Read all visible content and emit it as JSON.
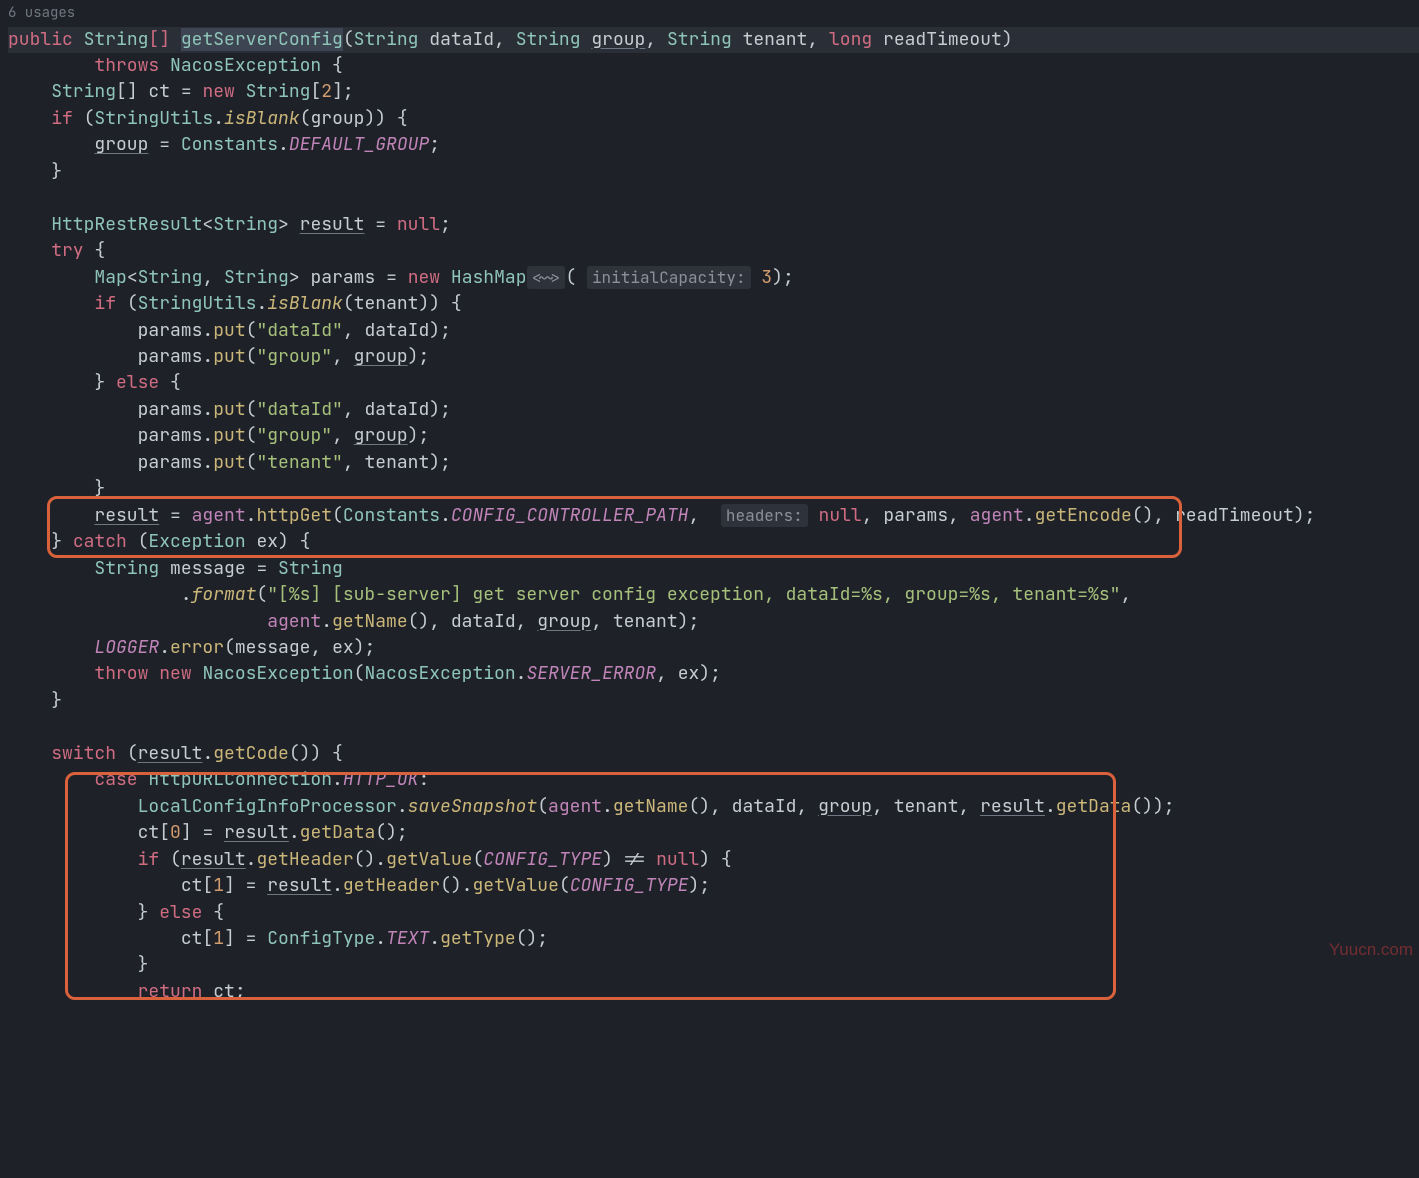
{
  "usages_label": "6 usages",
  "watermark": "Yuucn.com",
  "sig": {
    "public": "public",
    "string": "String",
    "brackets": "[]",
    "method": "getServerConfig",
    "p1t": "String",
    "p1n": "dataId",
    "p2t": "String",
    "p2n": "group",
    "p3t": "String",
    "p3n": "tenant",
    "p4t": "long",
    "p4n": "readTimeout",
    "throws": "throws",
    "exc": "NacosException"
  },
  "l": {
    "String": "String",
    "ct": "ct",
    "new": "new",
    "two": "2",
    "if": "if",
    "StringUtils": "StringUtils",
    "isBlank": "isBlank",
    "group": "group",
    "Constants": "Constants",
    "DEFAULT_GROUP": "DEFAULT_GROUP",
    "HttpRestResult": "HttpRestResult",
    "result": "result",
    "null": "null",
    "try": "try",
    "Map": "Map",
    "params": "params",
    "HashMap": "HashMap",
    "diamond": "<~>",
    "initialCapacity": "initialCapacity:",
    "three": "3",
    "tenant": "tenant",
    "put": "put",
    "dataIdStr": "\"dataId\"",
    "groupStr": "\"group\"",
    "tenantStr": "\"tenant\"",
    "dataId": "dataId",
    "else": "else",
    "agent": "agent",
    "httpGet": "httpGet",
    "CONFIG_CONTROLLER_PATH": "CONFIG_CONTROLLER_PATH",
    "headers": "headers:",
    "getEncode": "getEncode",
    "readTimeout": "readTimeout",
    "catch": "catch",
    "Exception": "Exception",
    "ex": "ex",
    "message": "message",
    "format": "format",
    "formatStr": "\"[%s] [sub-server] get server config exception, dataId=%s, group=%s, tenant=%s\"",
    "getName": "getName",
    "LOGGER": "LOGGER",
    "error": "error",
    "throw": "throw",
    "NacosException": "NacosException",
    "SERVER_ERROR": "SERVER_ERROR",
    "switch": "switch",
    "getCode": "getCode",
    "case": "case",
    "HttpURLConnection": "HttpURLConnection",
    "HTTP_OK": "HTTP_OK",
    "LocalConfigInfoProcessor": "LocalConfigInfoProcessor",
    "saveSnapshot": "saveSnapshot",
    "getData": "getData",
    "zero": "0",
    "one": "1",
    "getHeader": "getHeader",
    "getValue": "getValue",
    "CONFIG_TYPE": "CONFIG_TYPE",
    "ConfigType": "ConfigType",
    "TEXT": "TEXT",
    "getType": "getType",
    "return": "return"
  }
}
